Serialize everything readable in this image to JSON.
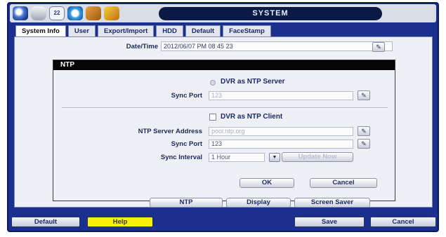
{
  "window": {
    "title": "SYSTEM"
  },
  "toolbar": {
    "icons": [
      "dvr-logo-icon",
      "camera-icon",
      "calendar-icon",
      "network-icon",
      "tools-icon",
      "pencil-icon"
    ],
    "calendar_text": "22"
  },
  "tabs": [
    {
      "label": "System Info",
      "active": true
    },
    {
      "label": "User",
      "active": false
    },
    {
      "label": "Export/Import",
      "active": false
    },
    {
      "label": "HDD",
      "active": false
    },
    {
      "label": "Default",
      "active": false
    },
    {
      "label": "FaceStamp",
      "active": false
    }
  ],
  "datetime": {
    "label": "Date/Time",
    "value": "2012/06/07 PM 08 45 23"
  },
  "ntp": {
    "title": "NTP",
    "server_option_label": "DVR as NTP Server",
    "server_sync_port_label": "Sync Port",
    "server_sync_port_value": "123",
    "client_option_label": "DVR as NTP Client",
    "client_checked": false,
    "server_address_label": "NTP Server Address",
    "server_address_value": "pool.ntp.org",
    "client_sync_port_label": "Sync Port",
    "client_sync_port_value": "123",
    "sync_interval_label": "Sync Interval",
    "sync_interval_value": "1 Hour",
    "update_now_label": "Update Now",
    "ok_label": "OK",
    "cancel_label": "Cancel"
  },
  "sub_buttons": [
    "NTP",
    "Display",
    "Screen Saver"
  ],
  "bottom": {
    "default_label": "Default",
    "help_label": "Help",
    "save_label": "Save",
    "cancel_label": "Cancel"
  },
  "colors": {
    "frame": "#1b2f8f",
    "help": "#f6ef08",
    "dialog_header": "#050505"
  }
}
